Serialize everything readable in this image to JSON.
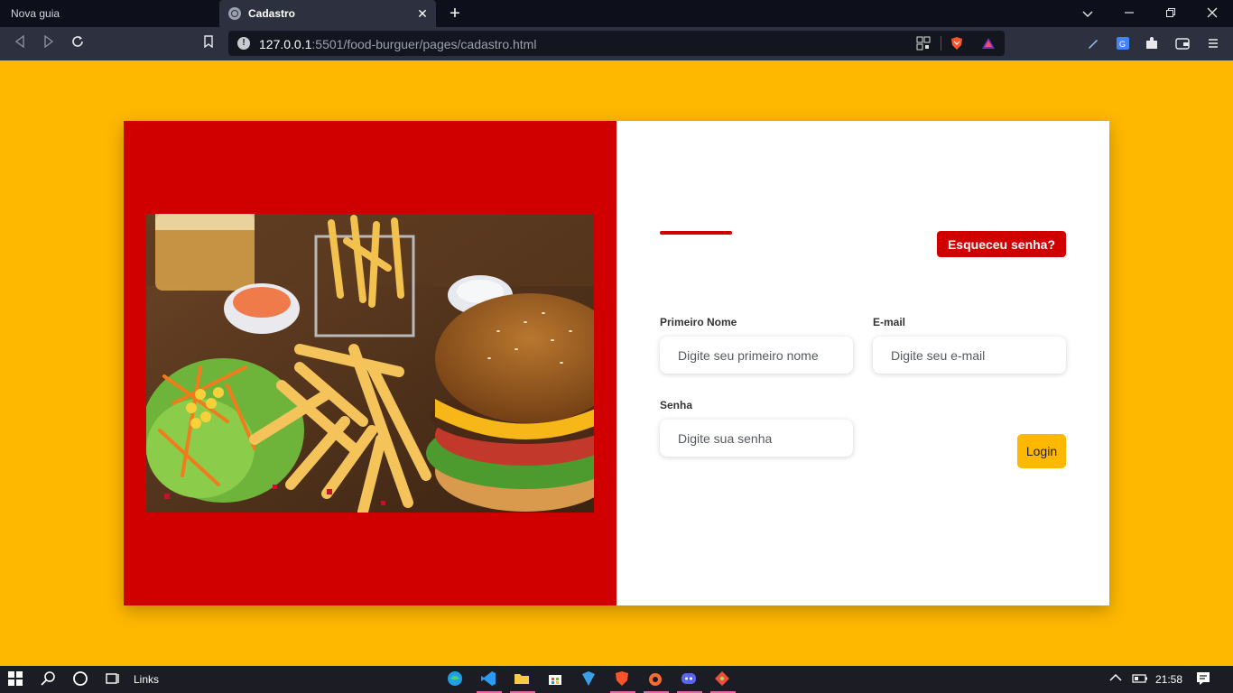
{
  "browser": {
    "tabs": [
      {
        "label": "Nova guia",
        "active": false
      },
      {
        "label": "Cadastro",
        "active": true
      }
    ],
    "url": {
      "host": "127.0.0.1",
      "rest": ":5501/food-burguer/pages/cadastro.html"
    },
    "window_controls": [
      "chevron-down",
      "minimize",
      "restore",
      "close"
    ]
  },
  "page": {
    "colors": {
      "background": "#ffb800",
      "panel_red": "#d00000",
      "panel_white": "#ffffff",
      "accent": "#d00000",
      "login_button": "#ffb800"
    },
    "image_alt": "burger-fries-salad-photo",
    "forgot_button": "Esqueceu senha?",
    "form": {
      "first_name": {
        "label": "Primeiro Nome",
        "placeholder": "Digite seu primeiro nome"
      },
      "email": {
        "label": "E-mail",
        "placeholder": "Digite seu e-mail"
      },
      "password": {
        "label": "Senha",
        "placeholder": "Digite sua senha"
      },
      "submit": "Login"
    }
  },
  "taskbar": {
    "links_label": "Links",
    "time": "21:58",
    "apps": [
      "edge",
      "vscode",
      "file-explorer",
      "store",
      "azure-data-studio",
      "brave",
      "origin",
      "discord",
      "git"
    ]
  }
}
